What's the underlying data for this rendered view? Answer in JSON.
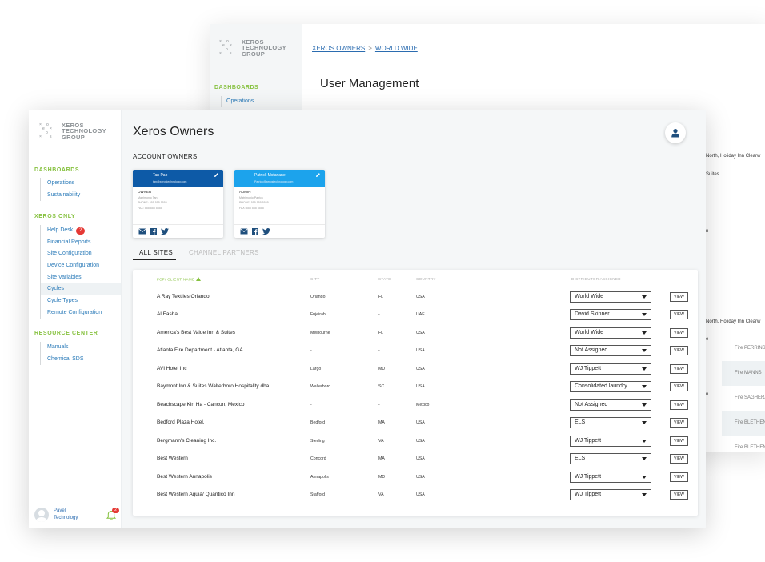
{
  "brand": {
    "logo_text_lines": [
      "XEROS",
      "TECHNOLOGY",
      "GROUP"
    ]
  },
  "back_window": {
    "sidebar": {
      "section": "DASHBOARDS",
      "item": "Operations"
    },
    "breadcrumb": [
      "XEROS OWNERS",
      "WORLD WIDE"
    ],
    "breadcrumb_sep": ">",
    "title": "User Management",
    "peek_text": [
      "North, Holiday Inn Clearw",
      "Suites",
      "n",
      "North, Holiday Inn Clearw",
      "e",
      "n"
    ],
    "peek_rows": [
      "Fire PERRINS",
      "Fire MANNS",
      "Fire SAGHERA",
      "Fire BLETHEN",
      "Fire BLETHEN"
    ]
  },
  "sidebar": {
    "sections": [
      {
        "title": "DASHBOARDS",
        "items": [
          "Operations",
          "Sustainability"
        ]
      },
      {
        "title": "XEROS ONLY",
        "items": [
          "Help Desk",
          "Financial Reports",
          "Site Configuration",
          "Device Configuration",
          "Site Variables",
          "Cycles",
          "Cycle Types",
          "Remote Configuration"
        ]
      },
      {
        "title": "RESOURCE CENTER",
        "items": [
          "Manuals",
          "Chemical SDS"
        ]
      }
    ],
    "help_desk_badge": "2",
    "active_item": "Cycles",
    "user": {
      "name": "Pavel",
      "org": "Technology"
    },
    "notification_badge": "2"
  },
  "main": {
    "title": "Xeros Owners",
    "account_owners_label": "ACCOUNT OWNERS",
    "cards": [
      {
        "name": "Tan Pao",
        "email": "tan@xerostechnology.com",
        "role": "OWNER",
        "lines": [
          "Matrimonio Tan",
          "PHONE: 555 555 5555",
          "FAX: 555 555 5555"
        ],
        "color": "#0d5aa7"
      },
      {
        "name": "Patrick Mcfarlane",
        "email": "Patrick@xerostechnology.com",
        "role": "ADMIN",
        "lines": [
          "Matrimonio Patrick",
          "PHONE: 555 555 5555",
          "FAX: 555 555 5555"
        ],
        "color": "#1ca3ec"
      }
    ],
    "tabs": [
      "ALL SITES",
      "CHANNEL PARTNERS"
    ],
    "active_tab": "ALL SITES",
    "table": {
      "headers": {
        "name": "FCP/ CLIENT NAME",
        "city": "CITY",
        "state": "STATE",
        "country": "COUNTRY",
        "distributor": "DISTRIBUTOR ASSIGNED"
      },
      "view_label": "VIEW",
      "rows": [
        {
          "name": "A Ray Textiles  Orlando",
          "city": "Orlando",
          "state": "FL",
          "country": "USA",
          "distributor": "World Wide"
        },
        {
          "name": "Al Easha",
          "city": "Fujeirah",
          "state": "-",
          "country": "UAE",
          "distributor": "David Skinner"
        },
        {
          "name": "America's Best Value Inn & Suites",
          "city": "Melbourne",
          "state": "FL",
          "country": "USA",
          "distributor": "World Wide"
        },
        {
          "name": "Atlanta Fire Department - Atlanta, GA",
          "city": "-",
          "state": "-",
          "country": "USA",
          "distributor": "Not Assigned"
        },
        {
          "name": "AVI Hotel Inc",
          "city": "Largo",
          "state": "MD",
          "country": "USA",
          "distributor": "WJ Tippett"
        },
        {
          "name": "Baymont Inn & Suites Walterboro Hospitality dba",
          "city": "Walterboro",
          "state": "SC",
          "country": "USA",
          "distributor": "Consolidated laundry"
        },
        {
          "name": "Beachscape Kin Ha - Cancun, Mexico",
          "city": "-",
          "state": "-",
          "country": "Mexico",
          "distributor": "Not Assigned"
        },
        {
          "name": "Bedford Plaza Hotel,",
          "city": "Bedford",
          "state": "MA",
          "country": "USA",
          "distributor": "ELS"
        },
        {
          "name": "Bergmann's Cleaning Inc.",
          "city": "Sterling",
          "state": "VA",
          "country": "USA",
          "distributor": "WJ Tippett"
        },
        {
          "name": "Best Western",
          "city": "Concord",
          "state": "MA",
          "country": "USA",
          "distributor": "ELS"
        },
        {
          "name": "Best Western Annapolis",
          "city": "Annapolis",
          "state": "MD",
          "country": "USA",
          "distributor": "WJ Tippett"
        },
        {
          "name": "Best Western Aquia/ Quantico Inn",
          "city": "Stafford",
          "state": "VA",
          "country": "USA",
          "distributor": "WJ Tippett"
        }
      ]
    }
  },
  "colors": {
    "accent_green": "#86c13f",
    "link_blue": "#2b7bb9",
    "badge_red": "#e53935",
    "brand_blue": "#0d5aa7"
  },
  "icons": [
    "xeros-logo-icon",
    "user-icon",
    "pencil-icon",
    "mail-icon",
    "facebook-icon",
    "twitter-icon",
    "bell-icon",
    "sort-asc-icon",
    "dropdown-arrow-icon"
  ]
}
